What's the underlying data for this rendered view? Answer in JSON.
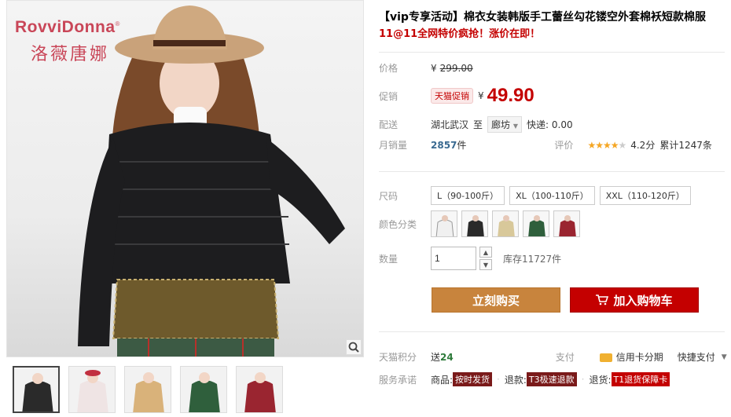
{
  "brand": {
    "name_en": "RovviDonna",
    "registered": "®",
    "name_cn": "洛薇唐娜"
  },
  "product": {
    "title": "【vip专享活动】棉衣女装韩版手工蕾丝勾花镂空外套棉袄短款棉服",
    "subtitle": "11@11全网特价疯抢！涨价在即！"
  },
  "price": {
    "label": "价格",
    "currency": "¥",
    "original": "299.00",
    "promo_label": "促销",
    "promo_badge": "天猫促销",
    "promo_price": "49.90"
  },
  "shipping": {
    "label": "配送",
    "from": "湖北武汉",
    "to_word": "至",
    "destination": "廊坊",
    "fee_text": "快递: 0.00"
  },
  "sales": {
    "label": "月销量",
    "count": "2857",
    "unit": "件",
    "rating_label": "评价",
    "rating": "4.2分",
    "reviews": "累计1247条",
    "stars_filled": 4,
    "stars_total": 5
  },
  "sizes": {
    "label": "尺码",
    "options": [
      "L（90-100斤）",
      "XL（100-110斤）",
      "XXL（110-120斤）"
    ]
  },
  "colors": {
    "label": "颜色分类",
    "swatches": [
      "#2a2a2a",
      "#3a3a3a",
      "#d8c89a",
      "#2f5f3c",
      "#9a2530"
    ]
  },
  "quantity": {
    "label": "数量",
    "value": "1",
    "stock": "库存11727件"
  },
  "actions": {
    "buy_now": "立刻购买",
    "add_cart": "加入购物车"
  },
  "points": {
    "label": "天猫积分",
    "give_word": "送",
    "amount": "24",
    "pay_label": "支付",
    "credit_card": "信用卡分期",
    "quick_pay": "快捷支付"
  },
  "service": {
    "label": "服务承诺",
    "goods_prefix": "商品:",
    "goods_tag": "按时发货",
    "refund_prefix": "退款:",
    "refund_tag": "T3极速退款",
    "return_prefix": "退货:",
    "return_tag": "T1退货保障卡"
  },
  "thumbnails": [
    "#2a2a2a",
    "#efe4e4",
    "#d9b27a",
    "#2f5f3c",
    "#9a2530"
  ],
  "colors_theme": {
    "accent_red": "#c40000",
    "buy_orange": "#c8843d"
  }
}
